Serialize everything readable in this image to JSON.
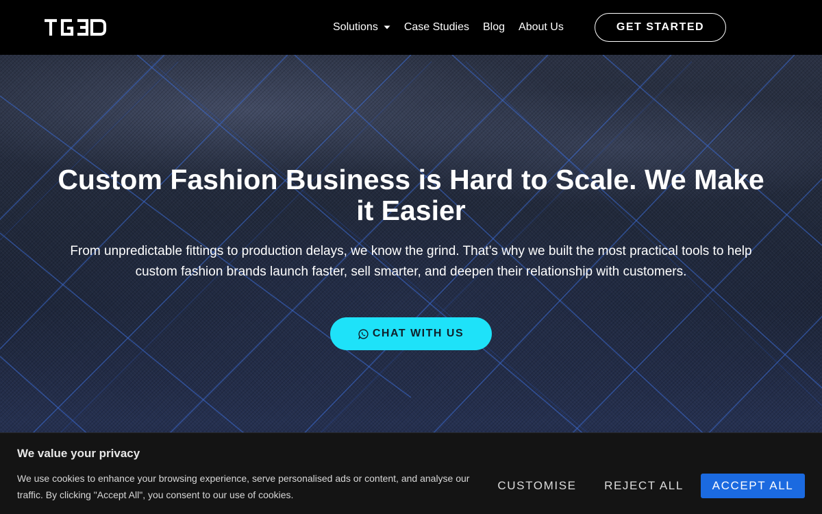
{
  "nav": {
    "logo_text": "TG3D",
    "menu": [
      {
        "label": "Solutions",
        "has_dropdown": true
      },
      {
        "label": "Case Studies"
      },
      {
        "label": "Blog"
      },
      {
        "label": "About Us"
      }
    ],
    "cta_label": "GET STARTED"
  },
  "hero": {
    "title": "Custom Fashion Business is Hard to Scale. We Make it Easier",
    "subtitle": "From unpredictable fittings to production delays, we know the grind. That’s why we built the most practical tools to help custom fashion brands launch faster, sell smarter, and deepen their relationship with customers.",
    "chat_label": "CHAT WITH US",
    "chat_icon": "whatsapp-icon"
  },
  "cookie": {
    "title": "We value your privacy",
    "text": "We use cookies to enhance your browsing experience, serve personalised ads or content, and analyse our traffic. By clicking \"Accept All\", you consent to our use of cookies.",
    "customise_label": "CUSTOMISE",
    "reject_label": "REJECT ALL",
    "accept_label": "ACCEPT ALL"
  },
  "colors": {
    "nav_bg": "#000000",
    "chat_button": "#1ee2f9",
    "accept_button": "#1b6ae0",
    "cookie_bg": "#141414"
  }
}
